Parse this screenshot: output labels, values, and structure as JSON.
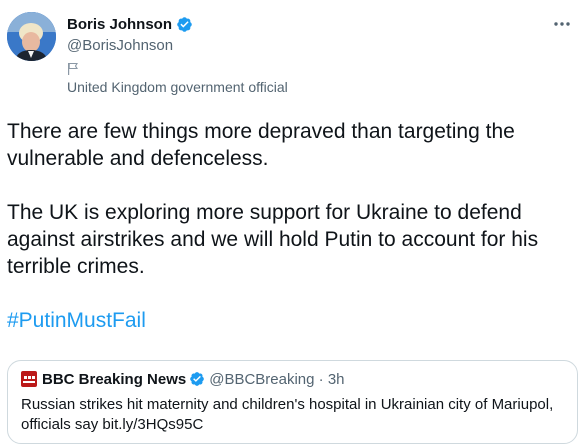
{
  "author": {
    "name": "Boris Johnson",
    "handle": "@BorisJohnson",
    "label": "United Kingdom government official"
  },
  "tweet": {
    "paragraphs": [
      "There are few things more depraved than targeting the vulnerable and defenceless.",
      "The UK is exploring more support for Ukraine to defend against airstrikes and we will hold Putin to account for his terrible crimes."
    ],
    "hashtag": "#PutinMustFail"
  },
  "quote": {
    "name": "BBC Breaking News",
    "handle_time": "@BBCBreaking · 3h",
    "text": "Russian strikes hit maternity and children's hospital in Ukrainian city of Mariupol, officials say bit.ly/3HQs95C"
  },
  "colors": {
    "link": "#1d9bf0",
    "verified": "#1d9bf0",
    "secondary_text": "#536471",
    "bbc_red": "#bb1919"
  },
  "icons": [
    "avatar",
    "verified-badge-icon",
    "flag-icon",
    "more-options-icon",
    "bbc-logo"
  ]
}
